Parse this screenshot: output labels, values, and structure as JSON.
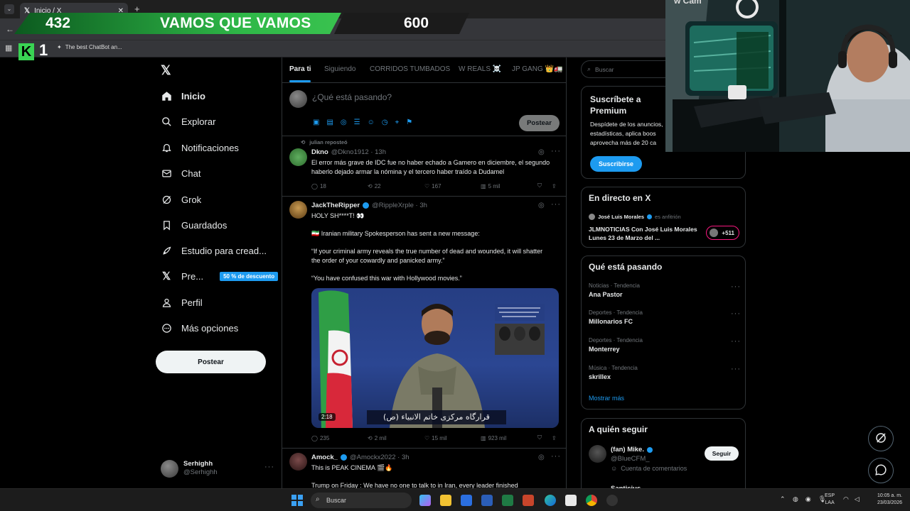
{
  "browser": {
    "tab_title": "Inicio / X",
    "bookmark": "The best ChatBot an..."
  },
  "banner": {
    "left_number": "432",
    "text": "VAMOS QUE VAMOS",
    "right_number": "600",
    "logo_letter": "K",
    "logo_number": "1"
  },
  "sidebar": {
    "items": [
      {
        "label": "Inicio",
        "icon": "home-icon"
      },
      {
        "label": "Explorar",
        "icon": "search-icon"
      },
      {
        "label": "Notificaciones",
        "icon": "bell-icon"
      },
      {
        "label": "Chat",
        "icon": "mail-icon"
      },
      {
        "label": "Grok",
        "icon": "grok-icon"
      },
      {
        "label": "Guardados",
        "icon": "bookmark-icon"
      },
      {
        "label": "Estudio para cread...",
        "icon": "rocket-icon"
      },
      {
        "label": "Pre...",
        "icon": "x-logo-icon"
      },
      {
        "label": "Perfil",
        "icon": "person-icon"
      },
      {
        "label": "Más opciones",
        "icon": "more-circle-icon"
      }
    ],
    "premium_badge": "50 % de descuento",
    "post_button": "Postear",
    "account": {
      "name": "Serhighh",
      "handle": "@Serhighh"
    }
  },
  "feed": {
    "tabs": [
      "Para ti",
      "Siguiendo",
      "CORRIDOS TUMBADOS",
      "W REALS ☠️",
      "JP GANG 👑🚛"
    ],
    "composer_placeholder": "¿Qué está pasando?",
    "composer_post": "Postear",
    "tweets": [
      {
        "repost_note": "julian reposteó",
        "name": "Dkno",
        "handle": "@Dkno1912 · 13h",
        "text": "El error más grave de IDC fue no haber echado a Gamero en diciembre, el segundo haberlo dejado armar la nómina y el tercero haber traído a Dudamel",
        "replies": "18",
        "reposts": "22",
        "likes": "167",
        "views": "5 mil"
      },
      {
        "name": "JackTheRipper",
        "handle": "@RippleXrple · 3h",
        "line1": "HOLY SH****T! 👀",
        "line2": "🇮🇷 Iranian military Spokesperson has sent a new message:",
        "line3": "“If your criminal army reveals the true number of dead and wounded, it will shatter the order of your cowardly and panicked army.”",
        "line4": "“You have confused this war with Hollywood movies.”",
        "video_time": "2:18",
        "video_caption": "قرارگاه مرکزی خاتم الانبیاء (ص)",
        "replies": "235",
        "reposts": "2 mil",
        "likes": "15 mil",
        "views": "923 mil"
      },
      {
        "name": "Amock_",
        "handle": "@Amockx2022 · 3h",
        "line1": "This is PEAK CINEMA 🎬🔥",
        "line2": "Trump on Friday : We have no one to talk to in Iran, every leader finished"
      }
    ]
  },
  "right": {
    "search_placeholder": "Buscar",
    "premium": {
      "title": "Suscríbete a Premium",
      "body": "Despídete de los anuncios, estadísticas, aplica boos aprovecha más de 20 ca",
      "button": "Suscribirse"
    },
    "live": {
      "title": "En directo en X",
      "host": "José Luis Morales",
      "host_role": "es anfitrión",
      "text": "JLMNOTICIAS  Con José Luis Morales Lunes 23 de Marzo del ...",
      "count": "+511"
    },
    "trends": {
      "title": "Qué está pasando",
      "items": [
        {
          "meta": "Noticias · Tendencia",
          "name": "Ana Pastor"
        },
        {
          "meta": "Deportes · Tendencia",
          "name": "Millonarios FC"
        },
        {
          "meta": "Deportes · Tendencia",
          "name": "Monterrey"
        },
        {
          "meta": "Música · Tendencia",
          "name": "skrillex"
        }
      ],
      "more": "Mostrar más"
    },
    "follow": {
      "title": "A quién seguir",
      "name": "(fan) Mike.",
      "handle": "@BlueCFM_",
      "note": "Cuenta de comentarios",
      "button": "Seguir",
      "next_name": "Santicius"
    }
  },
  "taskbar": {
    "search": "Buscar",
    "lang": "ESP",
    "lang2": "LAA",
    "time": "10:05 a. m.",
    "date": "23/03/2026"
  },
  "webcam_label": "w Cam"
}
